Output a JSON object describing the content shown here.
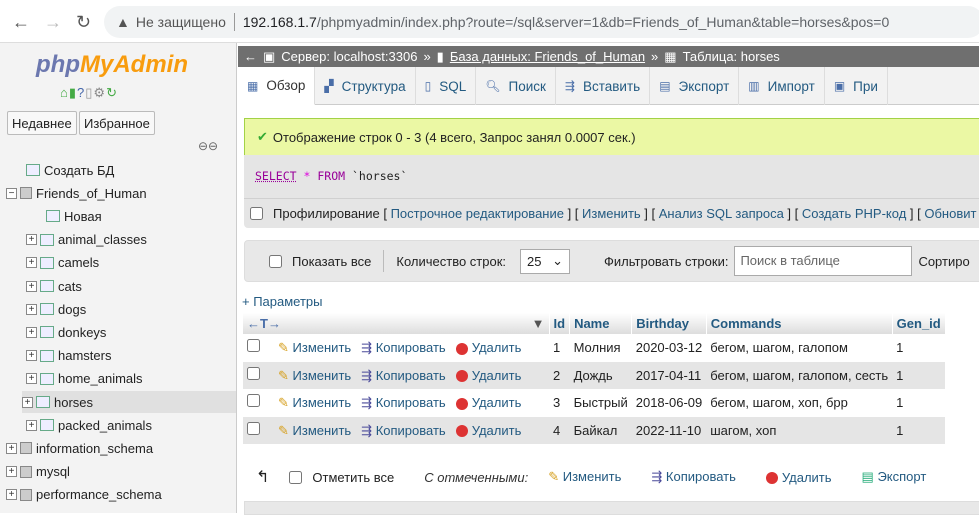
{
  "browser": {
    "security": "Не защищено",
    "url_host": "192.168.1.7",
    "url_path": "/phpmyadmin/index.php?route=/sql&server=1&db=Friends_of_Human&table=horses&pos=0"
  },
  "sidebar": {
    "logo_php": "php",
    "logo_myadmin": "MyAdmin",
    "recent": "Недавнее",
    "favorites": "Избранное",
    "tree": [
      {
        "label": "Создать БД",
        "level": 1,
        "type": "new"
      },
      {
        "label": "Friends_of_Human",
        "level": 0,
        "type": "db",
        "expanded": true
      },
      {
        "label": "Новая",
        "level": 2,
        "type": "new"
      },
      {
        "label": "animal_classes",
        "level": 1
      },
      {
        "label": "camels",
        "level": 1
      },
      {
        "label": "cats",
        "level": 1
      },
      {
        "label": "dogs",
        "level": 1
      },
      {
        "label": "donkeys",
        "level": 1
      },
      {
        "label": "hamsters",
        "level": 1
      },
      {
        "label": "home_animals",
        "level": 1
      },
      {
        "label": "horses",
        "level": 1,
        "selected": true
      },
      {
        "label": "packed_animals",
        "level": 1
      },
      {
        "label": "information_schema",
        "level": 0,
        "type": "db"
      },
      {
        "label": "mysql",
        "level": 0,
        "type": "db"
      },
      {
        "label": "performance_schema",
        "level": 0,
        "type": "db"
      }
    ]
  },
  "breadcrumb": {
    "server": "Сервер: localhost:3306",
    "database": "База данных: Friends_of_Human",
    "table": "Таблица: horses"
  },
  "tabs": [
    {
      "label": "Обзор",
      "icon": "browse-icon",
      "active": true
    },
    {
      "label": "Структура",
      "icon": "structure-icon"
    },
    {
      "label": "SQL",
      "icon": "sql-icon"
    },
    {
      "label": "Поиск",
      "icon": "search-icon"
    },
    {
      "label": "Вставить",
      "icon": "insert-icon"
    },
    {
      "label": "Экспорт",
      "icon": "export-icon"
    },
    {
      "label": "Импорт",
      "icon": "import-icon"
    },
    {
      "label": "При",
      "icon": "privileges-icon"
    }
  ],
  "message": "Отображение строк 0 - 3 (4 всего, Запрос занял 0.0007 сек.)",
  "sql": {
    "select": "SELECT",
    "star": "*",
    "from": "FROM",
    "table": "`horses`"
  },
  "profiling": {
    "label": "Профилирование",
    "links": [
      "Построчное редактирование",
      "Изменить",
      "Анализ SQL запроса",
      "Создать PHP-код",
      "Обновит"
    ]
  },
  "controls": {
    "show_all": "Показать все",
    "rows_label": "Количество строк:",
    "rows_value": "25",
    "filter_label": "Фильтровать строки:",
    "filter_placeholder": "Поиск в таблице",
    "sort_label": "Сортиро"
  },
  "params": "+ Параметры",
  "table": {
    "columns": [
      "Id",
      "Name",
      "Birthday",
      "Commands",
      "Gen_id"
    ],
    "actions": {
      "edit": "Изменить",
      "copy": "Копировать",
      "delete": "Удалить"
    },
    "rows": [
      [
        "1",
        "Молния",
        "2020-03-12",
        "бегом, шагом, галопом",
        "1"
      ],
      [
        "2",
        "Дождь",
        "2017-04-11",
        "бегом, шагом, галопом, сесть",
        "1"
      ],
      [
        "3",
        "Быстрый",
        "2018-06-09",
        "бегом, шагом, хоп, брр",
        "1"
      ],
      [
        "4",
        "Байкал",
        "2022-11-10",
        "шагом, хоп",
        "1"
      ]
    ]
  },
  "footer": {
    "check_all": "Отметить все",
    "with_selected": "С отмеченными:",
    "edit": "Изменить",
    "copy": "Копировать",
    "delete": "Удалить",
    "export": "Экспорт"
  }
}
